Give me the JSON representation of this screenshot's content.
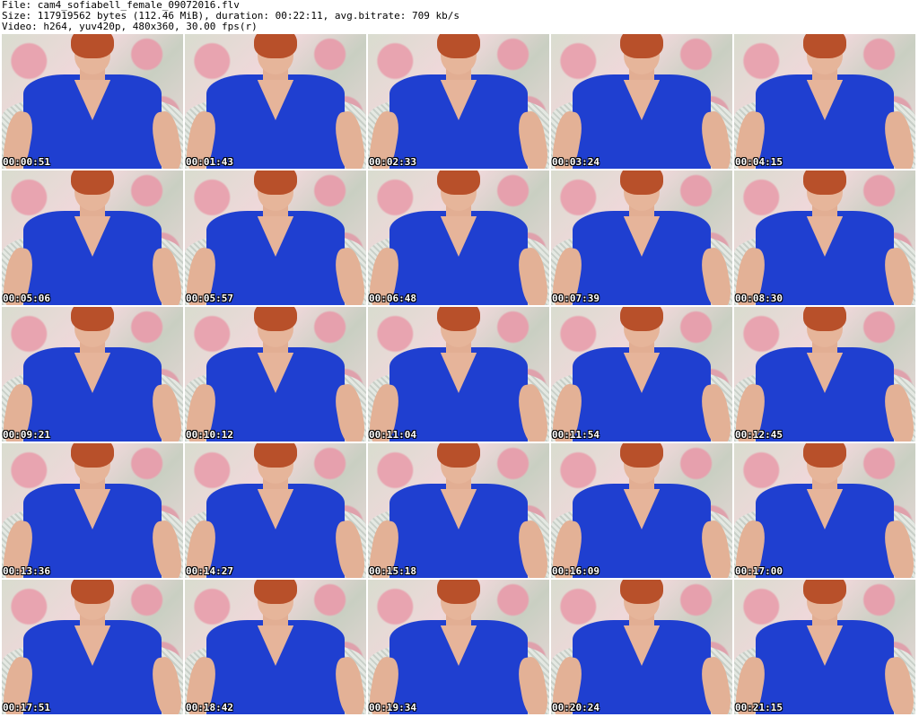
{
  "info": {
    "line1": "File: cam4_sofiabell_female_09072016.flv",
    "line2": "Size: 117919562 bytes (112.46 MiB), duration: 00:22:11, avg.bitrate: 709 kb/s",
    "line3": "Video: h264, yuv420p, 480x360, 30.00 fps(r)"
  },
  "thumbnails": [
    {
      "timestamp": "00:00:51"
    },
    {
      "timestamp": "00:01:43"
    },
    {
      "timestamp": "00:02:33"
    },
    {
      "timestamp": "00:03:24"
    },
    {
      "timestamp": "00:04:15"
    },
    {
      "timestamp": "00:05:06"
    },
    {
      "timestamp": "00:05:57"
    },
    {
      "timestamp": "00:06:48"
    },
    {
      "timestamp": "00:07:39"
    },
    {
      "timestamp": "00:08:30"
    },
    {
      "timestamp": "00:09:21"
    },
    {
      "timestamp": "00:10:12"
    },
    {
      "timestamp": "00:11:04"
    },
    {
      "timestamp": "00:11:54"
    },
    {
      "timestamp": "00:12:45"
    },
    {
      "timestamp": "00:13:36"
    },
    {
      "timestamp": "00:14:27"
    },
    {
      "timestamp": "00:15:18"
    },
    {
      "timestamp": "00:16:09"
    },
    {
      "timestamp": "00:17:00"
    },
    {
      "timestamp": "00:17:51"
    },
    {
      "timestamp": "00:18:42"
    },
    {
      "timestamp": "00:19:34"
    },
    {
      "timestamp": "00:20:24"
    },
    {
      "timestamp": "00:21:15"
    }
  ]
}
